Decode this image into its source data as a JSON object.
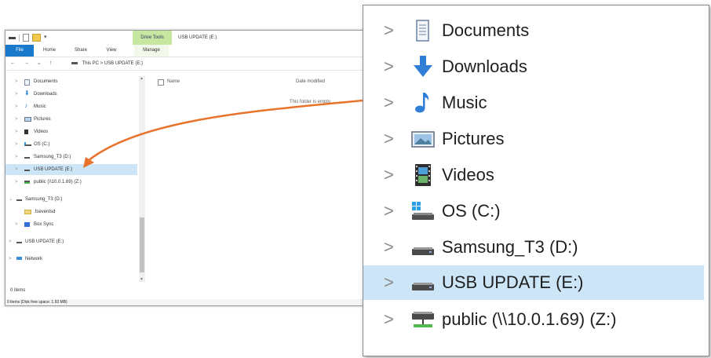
{
  "window": {
    "title": "USB UPDATE (E:)",
    "context_tab": "Drive Tools",
    "ribbon_tabs": {
      "file": "File",
      "home": "Home",
      "share": "Share",
      "view": "View",
      "manage": "Manage"
    },
    "nav_buttons": "← → ⌄ ↑",
    "address": {
      "this_pc": "This PC",
      "sep": ">",
      "drive": "USB UPDATE (E:)"
    },
    "nav_items": [
      {
        "label": "Documents",
        "icon": "documents-icon"
      },
      {
        "label": "Downloads",
        "icon": "downloads-icon"
      },
      {
        "label": "Music",
        "icon": "music-icon"
      },
      {
        "label": "Pictures",
        "icon": "pictures-icon"
      },
      {
        "label": "Videos",
        "icon": "videos-icon"
      },
      {
        "label": "OS (C:)",
        "icon": "os-drive-icon"
      },
      {
        "label": "Samsung_T3 (D:)",
        "icon": "drive-icon"
      },
      {
        "label": "USB UPDATE (E:)",
        "icon": "drive-icon",
        "selected": true
      },
      {
        "label": "public (\\\\10.0.1.69) (Z:)",
        "icon": "network-drive-icon"
      },
      {
        "label": "Samsung_T3 (D:)",
        "icon": "drive-icon"
      },
      {
        "label": ".fseventsd",
        "icon": "folder-icon"
      },
      {
        "label": "Box Sync",
        "icon": "box-sync-icon"
      },
      {
        "label": "USB UPDATE (E:)",
        "icon": "drive-icon"
      },
      {
        "label": "Network",
        "icon": "network-icon"
      }
    ],
    "columns": {
      "name": "Name",
      "date_modified": "Date modified"
    },
    "empty_message": "This folder is empty.",
    "item_count": "0 items",
    "status_text": "0 items (Disk free space: 1.93 MB)"
  },
  "zoom_items": [
    {
      "label": "Documents",
      "icon": "documents-icon"
    },
    {
      "label": "Downloads",
      "icon": "downloads-icon"
    },
    {
      "label": "Music",
      "icon": "music-icon"
    },
    {
      "label": "Pictures",
      "icon": "pictures-icon"
    },
    {
      "label": "Videos",
      "icon": "videos-icon"
    },
    {
      "label": "OS (C:)",
      "icon": "os-drive-icon"
    },
    {
      "label": "Samsung_T3 (D:)",
      "icon": "drive-icon"
    },
    {
      "label": "USB UPDATE (E:)",
      "icon": "drive-icon",
      "selected": true
    },
    {
      "label": "public (\\\\10.0.1.69) (Z:)",
      "icon": "network-drive-icon"
    }
  ],
  "colors": {
    "accent": "#1979ca",
    "selection": "#cde6f7",
    "context_tab": "#c6e7a0",
    "callout_arrow": "#e8732c"
  }
}
